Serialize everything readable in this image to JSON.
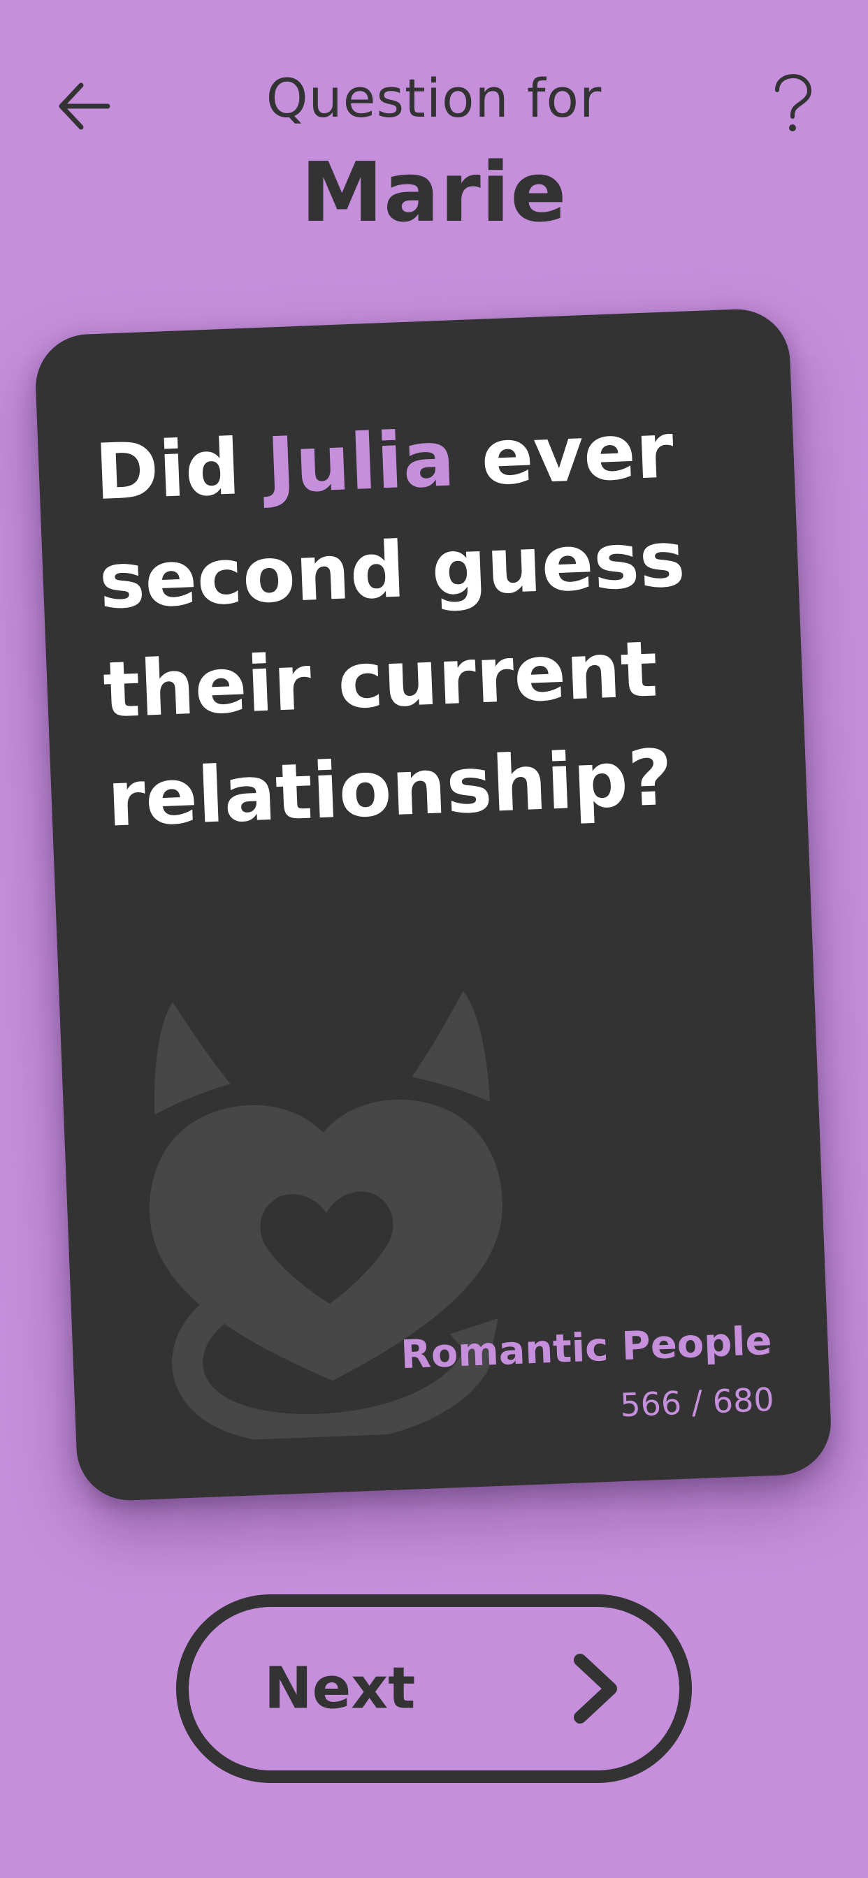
{
  "header": {
    "subtitle": "Question for",
    "player_name": "Marie",
    "back_icon": "arrow-left-icon",
    "help_label": "?"
  },
  "card": {
    "question_prefix": "Did ",
    "question_highlight": "Julia",
    "question_suffix": " ever second guess their current relationship?",
    "category": "Romantic People",
    "counter": "566 / 680",
    "graphic_icon": "devil-heart-icon"
  },
  "actions": {
    "next_label": "Next",
    "next_icon": "chevron-right-icon"
  },
  "colors": {
    "background": "#c68fdc",
    "card": "#333333",
    "accent": "#c68fdc",
    "text_dark": "#333333",
    "text_light": "#ffffff"
  }
}
